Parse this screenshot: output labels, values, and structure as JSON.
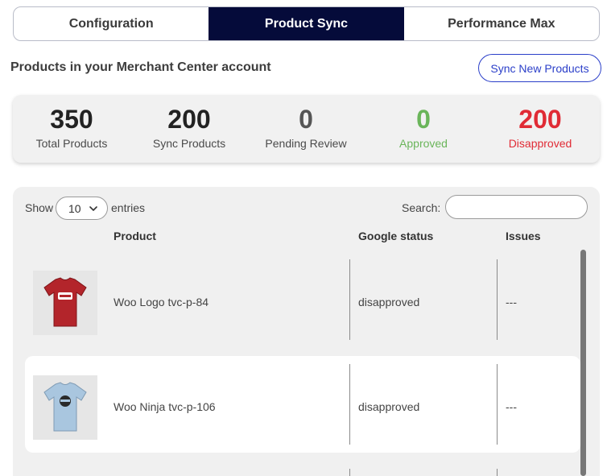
{
  "tabs": [
    {
      "label": "Configuration",
      "active": false
    },
    {
      "label": "Product Sync",
      "active": true
    },
    {
      "label": "Performance Max",
      "active": false
    }
  ],
  "section": {
    "title": "Products in your Merchant Center account",
    "sync_button": "Sync New Products"
  },
  "stats": [
    {
      "value": "350",
      "label": "Total Products",
      "color": "#222222"
    },
    {
      "value": "200",
      "label": "Sync Products",
      "color": "#222222"
    },
    {
      "value": "0",
      "label": "Pending Review",
      "color": "#555555"
    },
    {
      "value": "0",
      "label": "Approved",
      "color": "#6ab55a"
    },
    {
      "value": "200",
      "label": "Disapproved",
      "color": "#e02b35"
    }
  ],
  "table": {
    "show_label": "Show",
    "entries_value": "10",
    "entries_label": "entries",
    "search_label": "Search:",
    "search_value": "",
    "columns": [
      "Product",
      "Google status",
      "Issues"
    ],
    "rows": [
      {
        "product": "Woo Logo tvc-p-84",
        "status": "disapproved",
        "issues": "---",
        "thumb_color": "#b3252b",
        "thumb_icon": "woo-logo-tshirt"
      },
      {
        "product": "Woo Ninja tvc-p-106",
        "status": "disapproved",
        "issues": "---",
        "thumb_color": "#a9c6df",
        "thumb_icon": "woo-ninja-tshirt"
      }
    ]
  },
  "colors": {
    "active_tab": "#050b3a",
    "accent": "#2b3fc9",
    "approved": "#6ab55a",
    "disapproved": "#e02b35"
  }
}
